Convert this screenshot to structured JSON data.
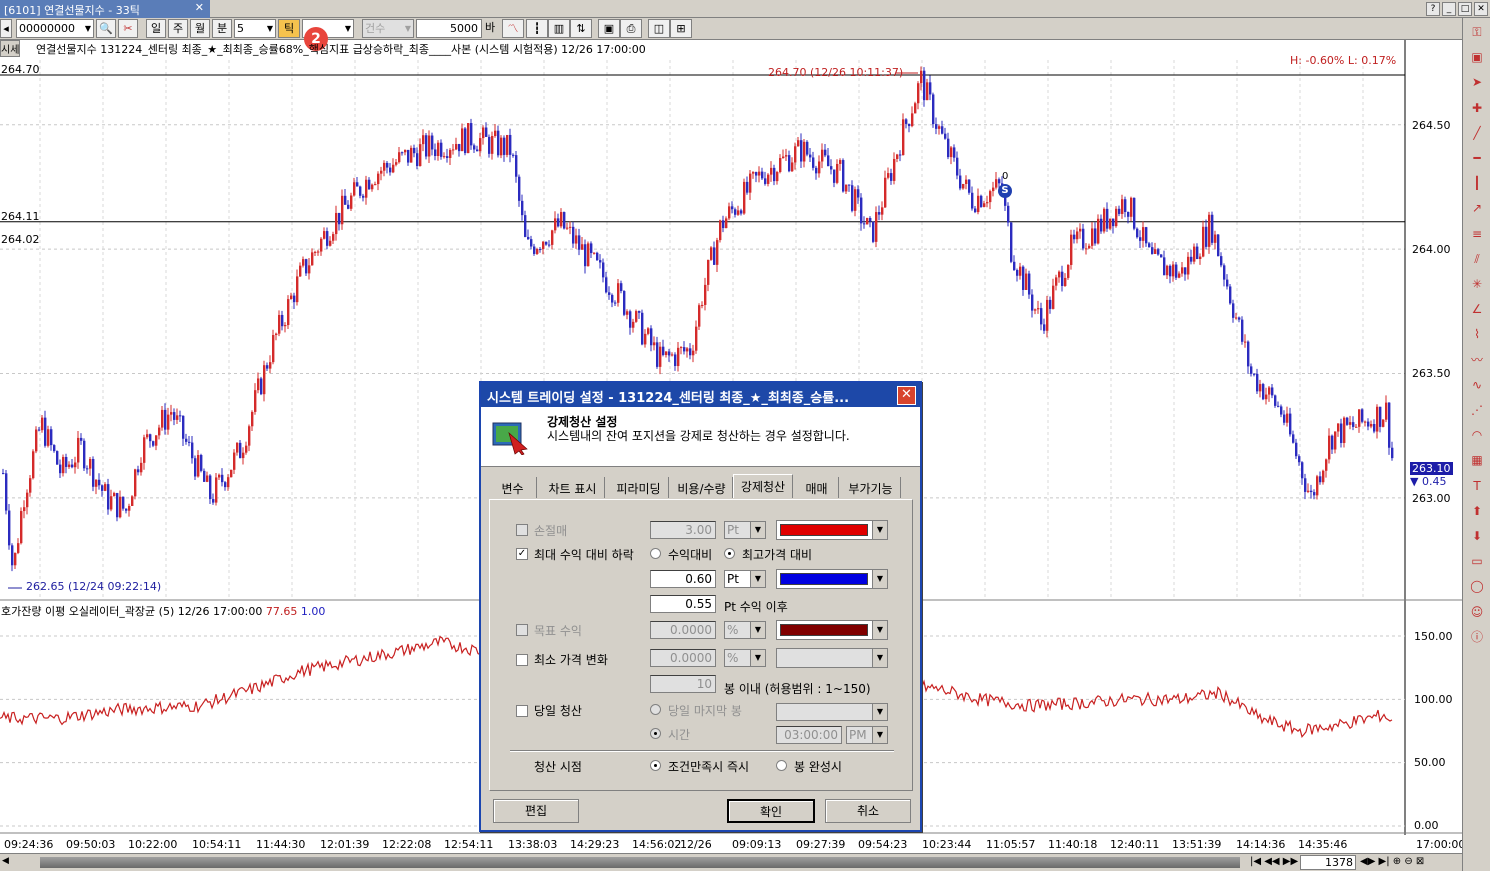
{
  "window": {
    "tab_title": "[6101] 연결선물지수 - 33틱",
    "tab_close": "✕",
    "buttons": [
      "?",
      "_",
      "□",
      "✕"
    ]
  },
  "toolbar": {
    "code_value": "00000000",
    "period_labels": [
      "일",
      "주",
      "월",
      "분"
    ],
    "minute_value": "5",
    "tick_label": "틱",
    "badge": "2",
    "count_label": "건수",
    "bars_value": "5000",
    "bars_unit": "바"
  },
  "chart": {
    "header_tag": "시세",
    "header_text": "연결선물지수 131224_센터링 최종_★_최최종_승률68%_핵심지표 급상승하락_최종____사본 (시스템 시험적용) 12/26 17:00:00",
    "hl_text": "H: -0.60%   L: 0.17%",
    "left_labels": [
      "264.70",
      "264.11",
      "264.02"
    ],
    "high_annotation": "264.70 (12/26 10:11:37)",
    "low_annotation": "262.65 (12/24 09:22:14)",
    "price_axis": [
      "264.50",
      "264.00",
      "263.50",
      "263.00"
    ],
    "current_price": "263.10",
    "current_change": "▼ 0.45",
    "signal_label": "S",
    "signal_count": "0",
    "osc_header": "호가잔량 이평 오실레이터_곽장균 (5) 12/26 17:00:00",
    "osc_value_red": "77.65",
    "osc_value_blue": "1.00",
    "osc_axis": [
      "150.00",
      "100.00",
      "50.00",
      "0.00"
    ],
    "time_labels": [
      "09:24:36",
      "09:50:03",
      "10:22:00",
      "10:54:11",
      "11:44:30",
      "12:01:39",
      "12:22:08",
      "12:54:11",
      "13:38:03",
      "14:29:23",
      "14:56:02",
      "12/26",
      "09:09:13",
      "09:27:39",
      "09:54:23",
      "10:23:44",
      "11:05:57",
      "11:40:18",
      "12:40:11",
      "13:51:39",
      "14:14:36",
      "14:35:46"
    ],
    "time_last": "17:00:00",
    "scroll_count": "1378",
    "colors": {
      "up": "#d42a2a",
      "down": "#2b2bbf",
      "osc": "#c82020"
    }
  },
  "dialog": {
    "title": "시스템 트레이딩 설정 - 131224_센터링 최종_★_최최종_승률...",
    "heading": "강제청산 설정",
    "description": "시스템내의 잔여 포지션을 강제로 청산하는 경우 설정합니다.",
    "tabs": [
      "변수",
      "차트 표시",
      "피라미딩",
      "비용/수량",
      "강제청산",
      "매매",
      "부가기능"
    ],
    "active_tab": "강제청산",
    "stop_loss": {
      "label": "손절매",
      "value": "3.00",
      "unit": "Pt",
      "color": "#e00000"
    },
    "max_profit_drop": {
      "label": "최대 수익 대비 하락",
      "opt1": "수익대비",
      "opt2": "최고가격 대비",
      "value": "0.60",
      "unit": "Pt",
      "value2": "0.55",
      "after_label": "Pt 수익 이후",
      "color": "#0000e0"
    },
    "target_profit": {
      "label": "목표 수익",
      "value": "0.0000",
      "unit": "%",
      "color": "#800000"
    },
    "min_price_change": {
      "label": "최소 가격 변화",
      "value": "0.0000",
      "unit": "%",
      "bars": "10",
      "bars_label": "봉 이내 (허용범위 : 1~150)"
    },
    "same_day": {
      "label": "당일 청산",
      "opt1": "당일 마지막 봉",
      "opt2": "시간",
      "time": "03:00:00",
      "ampm": "PM"
    },
    "exit_timing": {
      "label": "청산 시점",
      "opt1": "조건만족시 즉시",
      "opt2": "봉 완성시"
    },
    "buttons": {
      "edit": "편집",
      "ok": "확인",
      "cancel": "취소"
    }
  }
}
